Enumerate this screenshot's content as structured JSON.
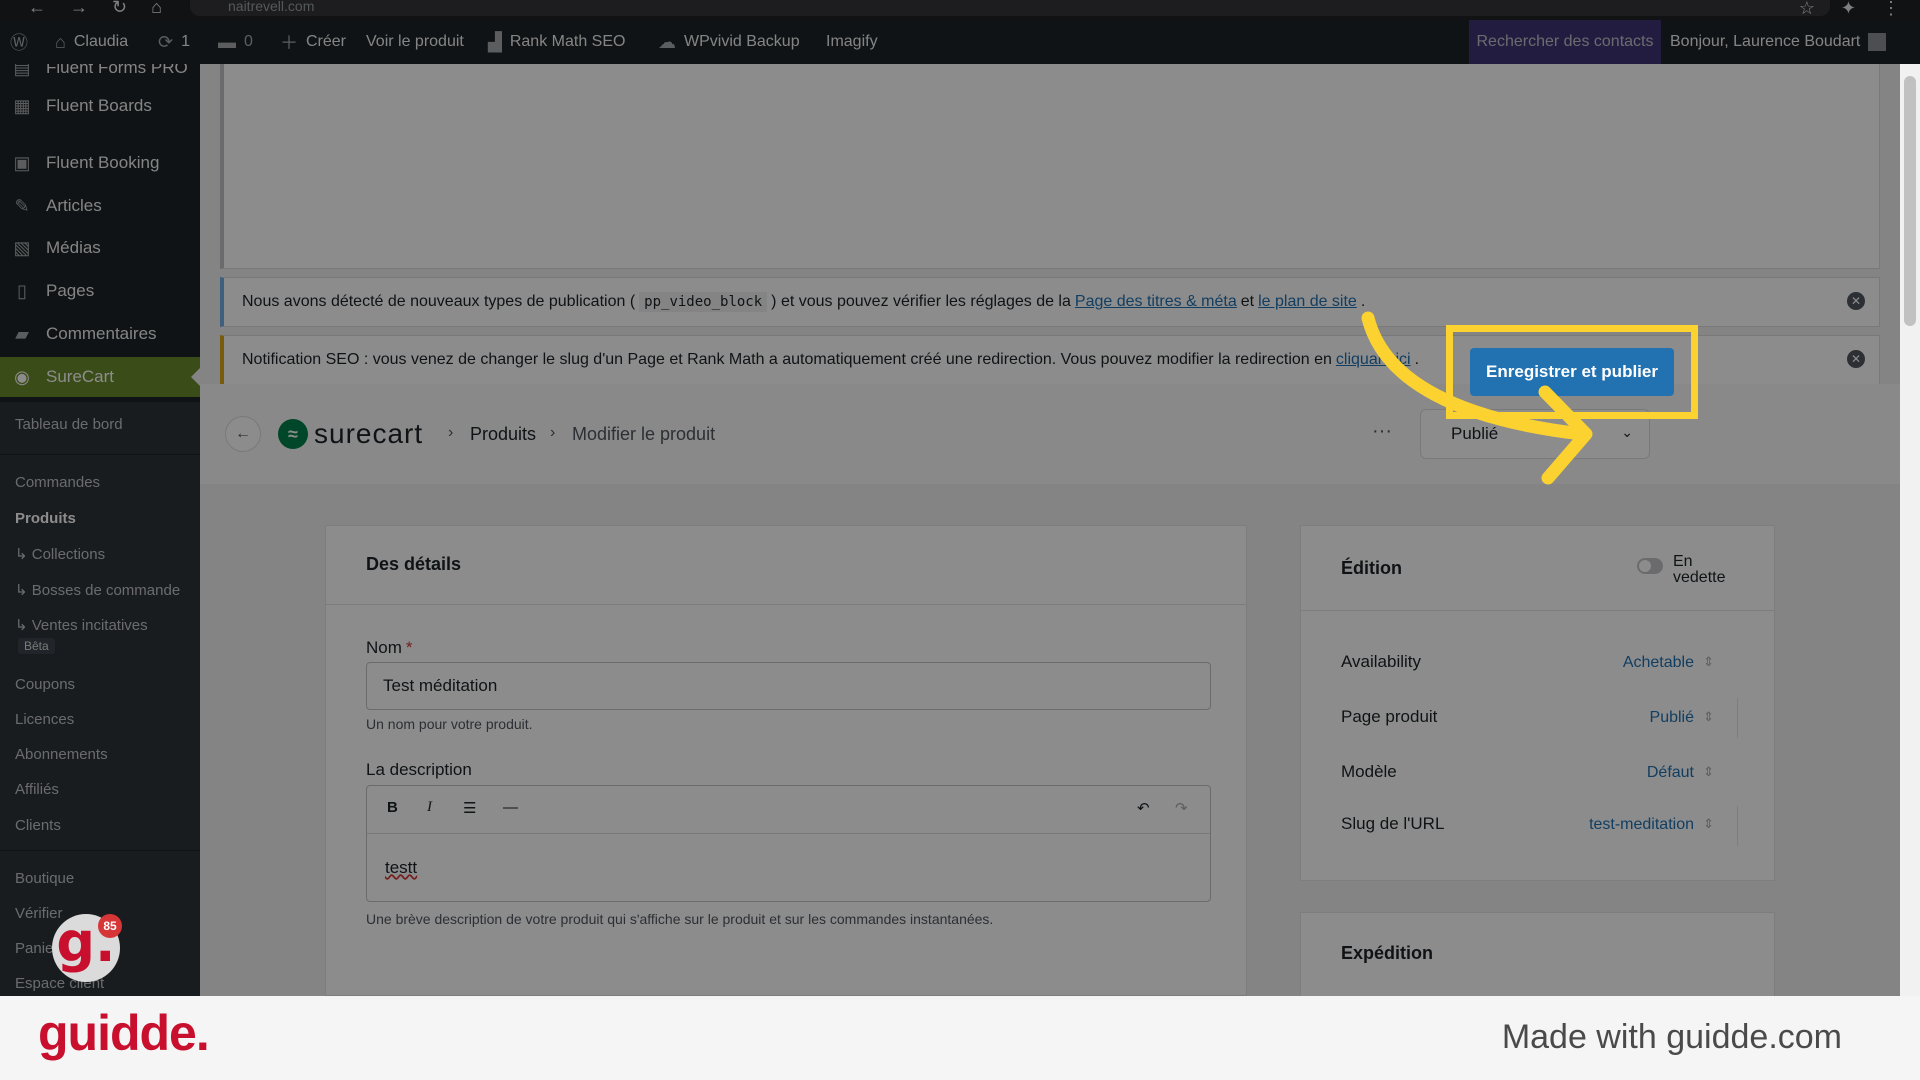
{
  "browser": {
    "url": "naitrevell.com"
  },
  "adminbar": {
    "site_name": "Claudia",
    "updates_count": "1",
    "comments_count": "0",
    "create": "Créer",
    "view_product": "Voir le produit",
    "rank_math": "Rank Math SEO",
    "wpvivid": "WPvivid Backup",
    "imagify": "Imagify",
    "search_contacts": "Rechercher des contacts",
    "greeting": "Bonjour, Laurence Boudart"
  },
  "sidebar": {
    "items": [
      {
        "label": "Fluent Forms PRO",
        "icon": "forms-icon"
      },
      {
        "label": "Fluent Boards",
        "icon": "boards-icon"
      },
      {
        "label": "Fluent Booking",
        "icon": "booking-icon"
      },
      {
        "label": "Articles",
        "icon": "pin-icon"
      },
      {
        "label": "Médias",
        "icon": "media-icon"
      },
      {
        "label": "Pages",
        "icon": "pages-icon"
      },
      {
        "label": "Commentaires",
        "icon": "comment-icon"
      },
      {
        "label": "SureCart",
        "icon": "surecart-icon"
      }
    ],
    "submenu": {
      "dashboard": "Tableau de bord",
      "orders": "Commandes",
      "products": "Produits",
      "collections": "Collections",
      "order_bumps": "Bosses de commande",
      "upsells": "Ventes incitatives",
      "beta": "Bêta",
      "coupons": "Coupons",
      "licenses": "Licences",
      "subscriptions": "Abonnements",
      "affiliates": "Affiliés",
      "clients": "Clients",
      "shop": "Boutique",
      "checkout": "Vérifier",
      "cart": "Panier",
      "customer_area": "Espace client"
    }
  },
  "notices": {
    "info_prefix": "Nous avons détecté de nouveaux types de publication (",
    "info_code": "pp_video_block",
    "info_mid": ") et vous pouvez vérifier les réglages de la",
    "info_link1": "Page des titres & méta",
    "info_and": "et",
    "info_link2": "le plan de site",
    "info_end": ".",
    "seo_text": "Notification SEO : vous venez de changer le slug d'un Page et Rank Math a automatiquement créé une redirection. Vous pouvez modifier la redirection en",
    "seo_link": "cliquant ici",
    "seo_end": "."
  },
  "header": {
    "logo_text": "surecart",
    "crumb_products": "Produits",
    "crumb_edit": "Modifier le produit",
    "more": "···",
    "status": "Publié",
    "publish_button": "Enregistrer et publier"
  },
  "details": {
    "title": "Des détails",
    "name_label": "Nom",
    "required_mark": "*",
    "name_value": "Test méditation",
    "name_help": "Un nom pour votre produit.",
    "description_label": "La description",
    "description_value": "testt",
    "description_help": "Une brève description de votre produit qui s'affiche sur le produit et sur les commandes instantanées."
  },
  "edition": {
    "title": "Édition",
    "featured_label": "En vedette",
    "featured_on": false,
    "props": [
      {
        "label": "Availability",
        "value": "Achetable"
      },
      {
        "label": "Page produit",
        "value": "Publié"
      },
      {
        "label": "Modèle",
        "value": "Défaut"
      },
      {
        "label": "Slug de l'URL",
        "value": "test-meditation"
      }
    ]
  },
  "shipping": {
    "title": "Expédition"
  },
  "guidde": {
    "badge_letter": "g.",
    "badge_count": "85",
    "brand": "guidde.",
    "made_with": "Made with guidde.com"
  },
  "colors": {
    "highlight": "#fbd230",
    "primary": "#2271b1",
    "surecart_green": "#01824c",
    "brand_red": "#c8102e"
  }
}
